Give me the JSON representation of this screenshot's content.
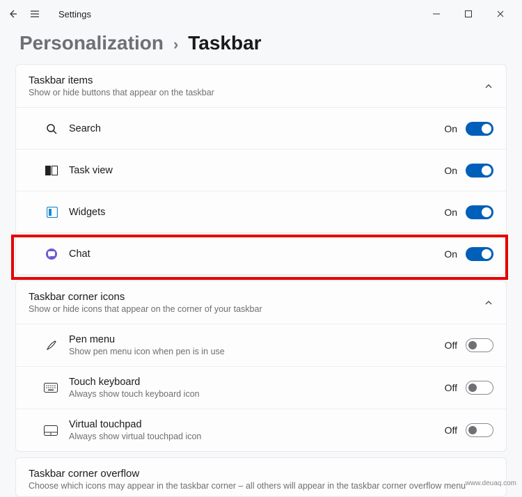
{
  "titlebar": {
    "app_title": "Settings"
  },
  "breadcrumb": {
    "parent": "Personalization",
    "chev": "›",
    "current": "Taskbar"
  },
  "sections": {
    "taskbar_items": {
      "title": "Taskbar items",
      "subtitle": "Show or hide buttons that appear on the taskbar",
      "rows": [
        {
          "label": "Search",
          "state": "On"
        },
        {
          "label": "Task view",
          "state": "On"
        },
        {
          "label": "Widgets",
          "state": "On"
        },
        {
          "label": "Chat",
          "state": "On"
        }
      ]
    },
    "corner_icons": {
      "title": "Taskbar corner icons",
      "subtitle": "Show or hide icons that appear on the corner of your taskbar",
      "rows": [
        {
          "label": "Pen menu",
          "sublabel": "Show pen menu icon when pen is in use",
          "state": "Off"
        },
        {
          "label": "Touch keyboard",
          "sublabel": "Always show touch keyboard icon",
          "state": "Off"
        },
        {
          "label": "Virtual touchpad",
          "sublabel": "Always show virtual touchpad icon",
          "state": "Off"
        }
      ]
    },
    "corner_overflow": {
      "title": "Taskbar corner overflow",
      "subtitle": "Choose which icons may appear in the taskbar corner – all others will appear in the taskbar corner overflow menu"
    }
  },
  "watermark": "www.deuaq.com"
}
